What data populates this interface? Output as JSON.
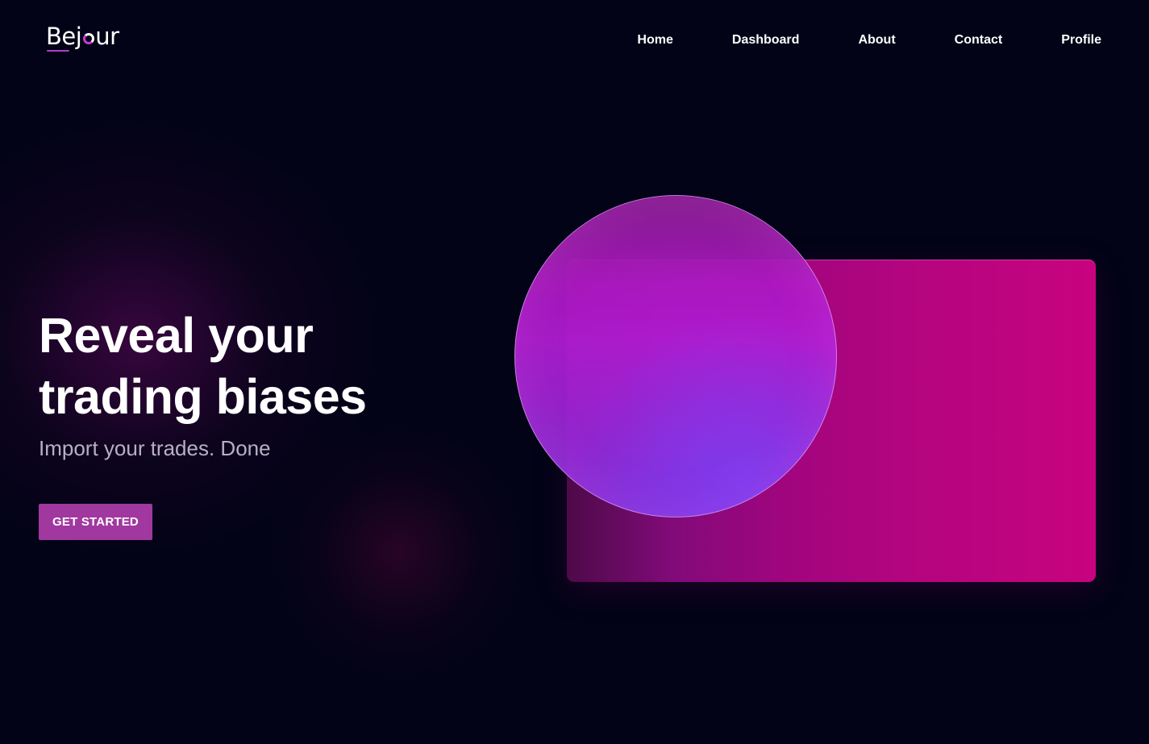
{
  "brand": {
    "logo_text_left": "Bej",
    "logo_text_right": "ur",
    "accent_color": "#b03ccc"
  },
  "nav": {
    "items": [
      {
        "label": "Home"
      },
      {
        "label": "Dashboard"
      },
      {
        "label": "About"
      },
      {
        "label": "Contact"
      },
      {
        "label": "Profile"
      }
    ]
  },
  "hero": {
    "title_line_1": "Reveal your",
    "title_line_2": "trading biases",
    "subtitle": "Import your trades. Done",
    "cta_label": "GET STARTED",
    "cta_color": "#a0389f"
  },
  "illustration": {
    "card_gradient": [
      "#4d0a48",
      "#c8037f"
    ],
    "orb_gradient": [
      "#86108f",
      "#8232df"
    ]
  },
  "colors": {
    "background": "#020316",
    "text_primary": "#ffffff",
    "text_muted": "#b7b0c4"
  }
}
